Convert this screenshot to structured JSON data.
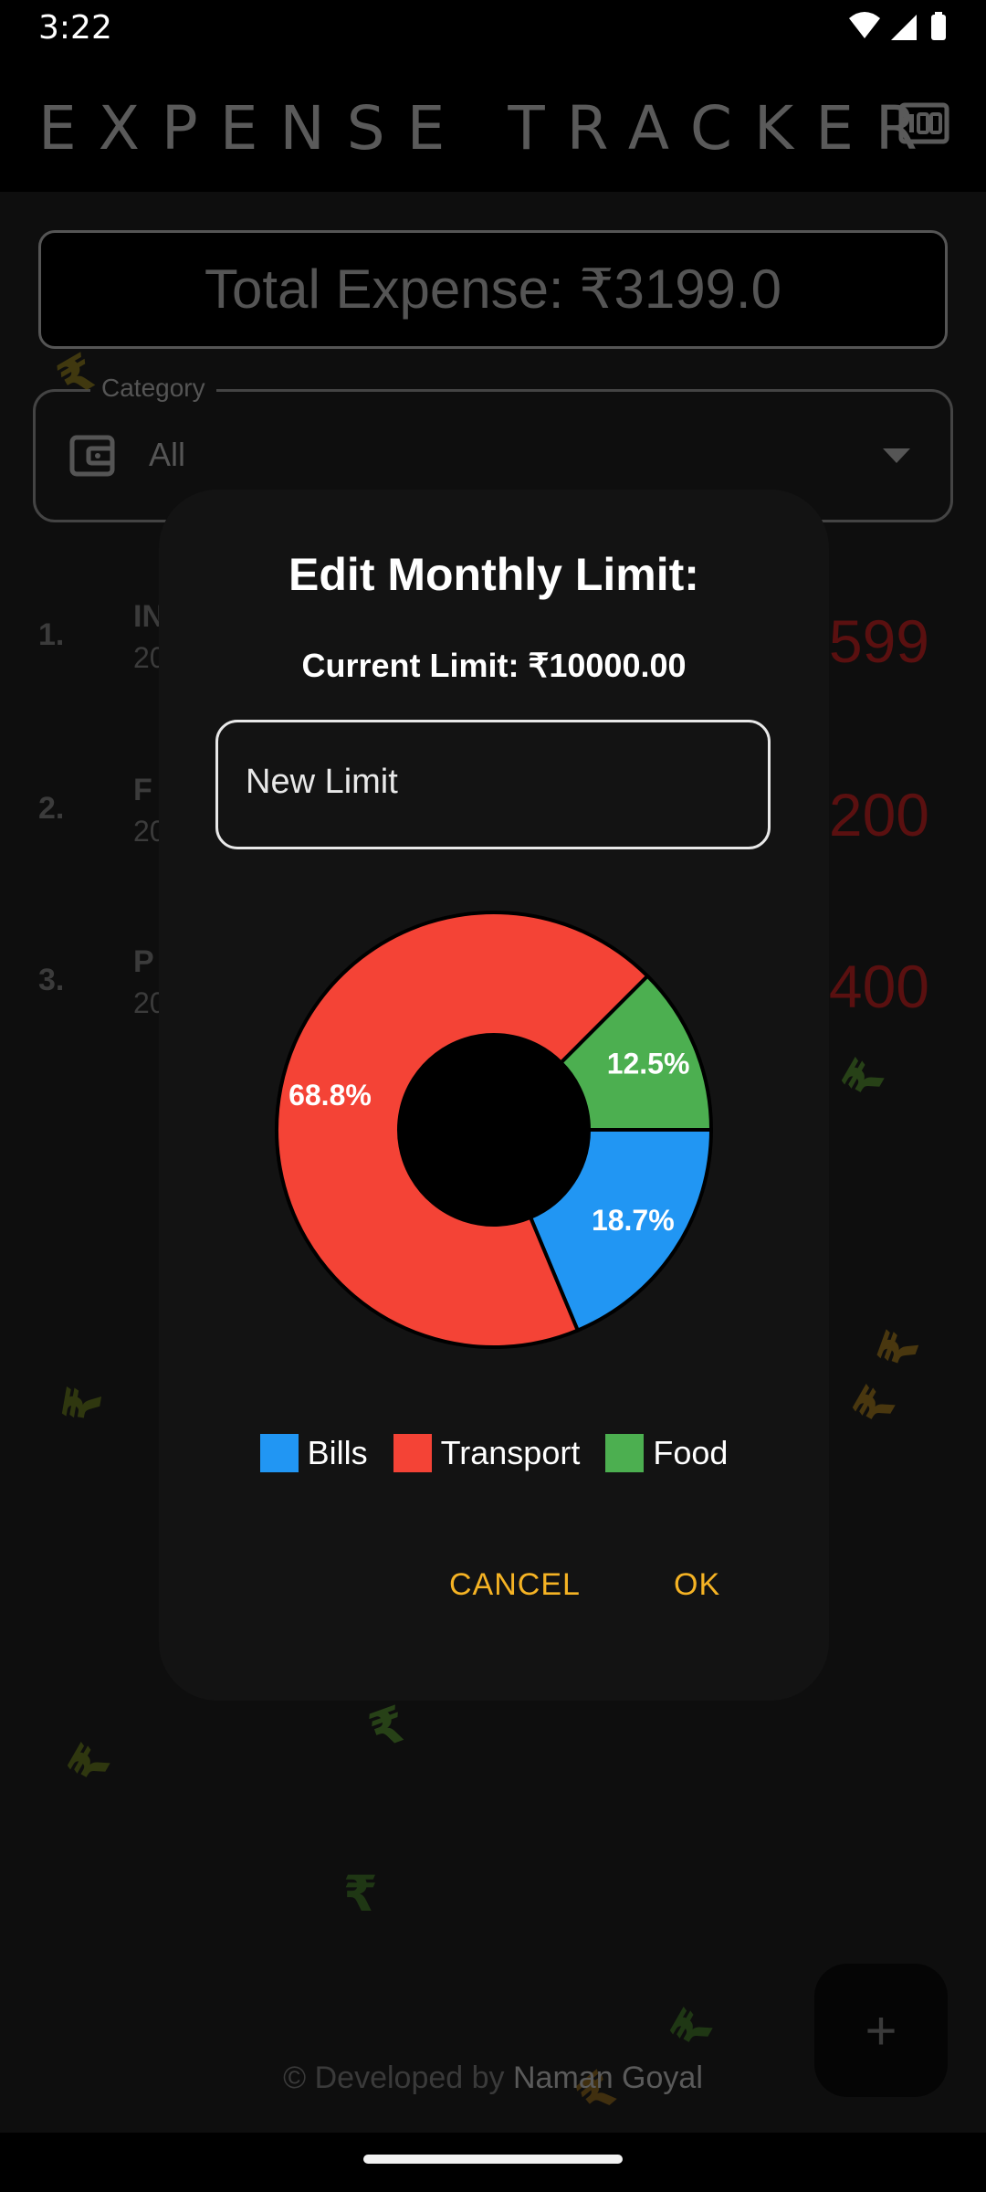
{
  "status_bar": {
    "time": "3:22"
  },
  "app_bar": {
    "title": "EXPENSE TRACKER"
  },
  "total": {
    "label": "Total Expense: ₹3199.0"
  },
  "category": {
    "legend": "Category",
    "value": "All"
  },
  "expenses": [
    {
      "index": "1.",
      "title": "IN",
      "sub": "20",
      "amount": "599"
    },
    {
      "index": "2.",
      "title": "F",
      "sub": "20",
      "amount": "200"
    },
    {
      "index": "3.",
      "title": "P",
      "sub": "20",
      "amount": "400"
    }
  ],
  "dialog": {
    "title": "Edit Monthly Limit:",
    "current_limit": "Current Limit: ₹10000.00",
    "input_label": "New Limit",
    "cancel_label": "CANCEL",
    "ok_label": "OK"
  },
  "chart_data": {
    "type": "pie",
    "categories": [
      "Bills",
      "Transport",
      "Food"
    ],
    "values": [
      18.7,
      68.8,
      12.5
    ],
    "labels": [
      "18.7%",
      "68.8%",
      "12.5%"
    ],
    "colors": [
      "#2196f3",
      "#f44336",
      "#4caf50"
    ],
    "legend": [
      "Bills",
      "Transport",
      "Food"
    ]
  },
  "footer": {
    "prefix": "© Developed by ",
    "author": "Naman Goyal"
  },
  "fab": {
    "label": "+"
  },
  "colors": {
    "accent": "#f5b324",
    "expense_amount": "#5a1010",
    "dialog_bg": "#131313"
  },
  "icons": [
    "wifi-icon",
    "signal-icon",
    "battery-icon",
    "limit-icon",
    "wallet-icon",
    "dropdown-icon",
    "add-icon",
    "rupee-icon"
  ],
  "decorative_symbol": "₹"
}
